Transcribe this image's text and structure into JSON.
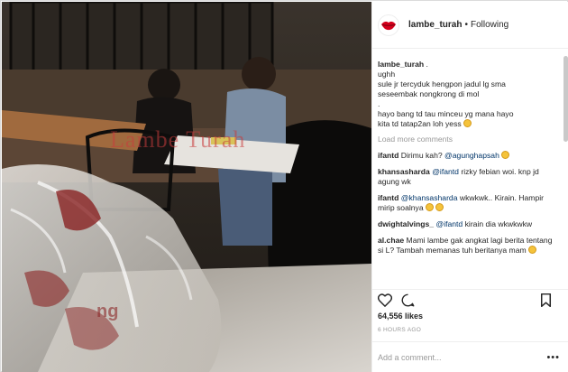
{
  "post": {
    "photo_watermark": "Lambe Turah",
    "photo_bag_text": "ng"
  },
  "header": {
    "username": "lambe_turah",
    "separator": "•",
    "follow_status": "Following",
    "avatar_icon": "lips-icon"
  },
  "caption": {
    "username": "lambe_turah",
    "suffix": ".",
    "lines": [
      "ughh",
      "sule jr tercyduk hengpon jadul lg sma",
      "seseembak nongkrong di mol",
      ".",
      "hayo bang td tau minceu yg mana hayo",
      "kita td tatap2an loh yess"
    ]
  },
  "load_more": "Load more comments",
  "comments": [
    {
      "user": "ifantd",
      "text": "Dirimu kah?",
      "mention": "@agunghapsah"
    },
    {
      "user": "khansasharda",
      "mention": "@ifantd",
      "text": "rizky febian woi. knp jd agung wk"
    },
    {
      "user": "ifantd",
      "mention": "@khansasharda",
      "text": "wkwkwk.. Kirain. Hampir mirip soalnya"
    },
    {
      "user": "dwightalvings_",
      "mention": "@ifantd",
      "text": "kirain dia wkwkwkw"
    },
    {
      "user": "al.chae",
      "text": "Mami lambe gak angkat lagi berita tentang si L? Tambah memanas tuh beritanya mam"
    }
  ],
  "actions": {
    "like_icon": "heart-icon",
    "comment_icon": "comment-bubble-icon",
    "save_icon": "bookmark-icon"
  },
  "likes_text": "64,556 likes",
  "timestamp": "6 HOURS AGO",
  "add_comment_placeholder": "Add a comment...",
  "more_options": "•••",
  "colors": {
    "link": "#003569",
    "muted": "#999999",
    "text": "#262626",
    "border": "#dbdbdb"
  }
}
